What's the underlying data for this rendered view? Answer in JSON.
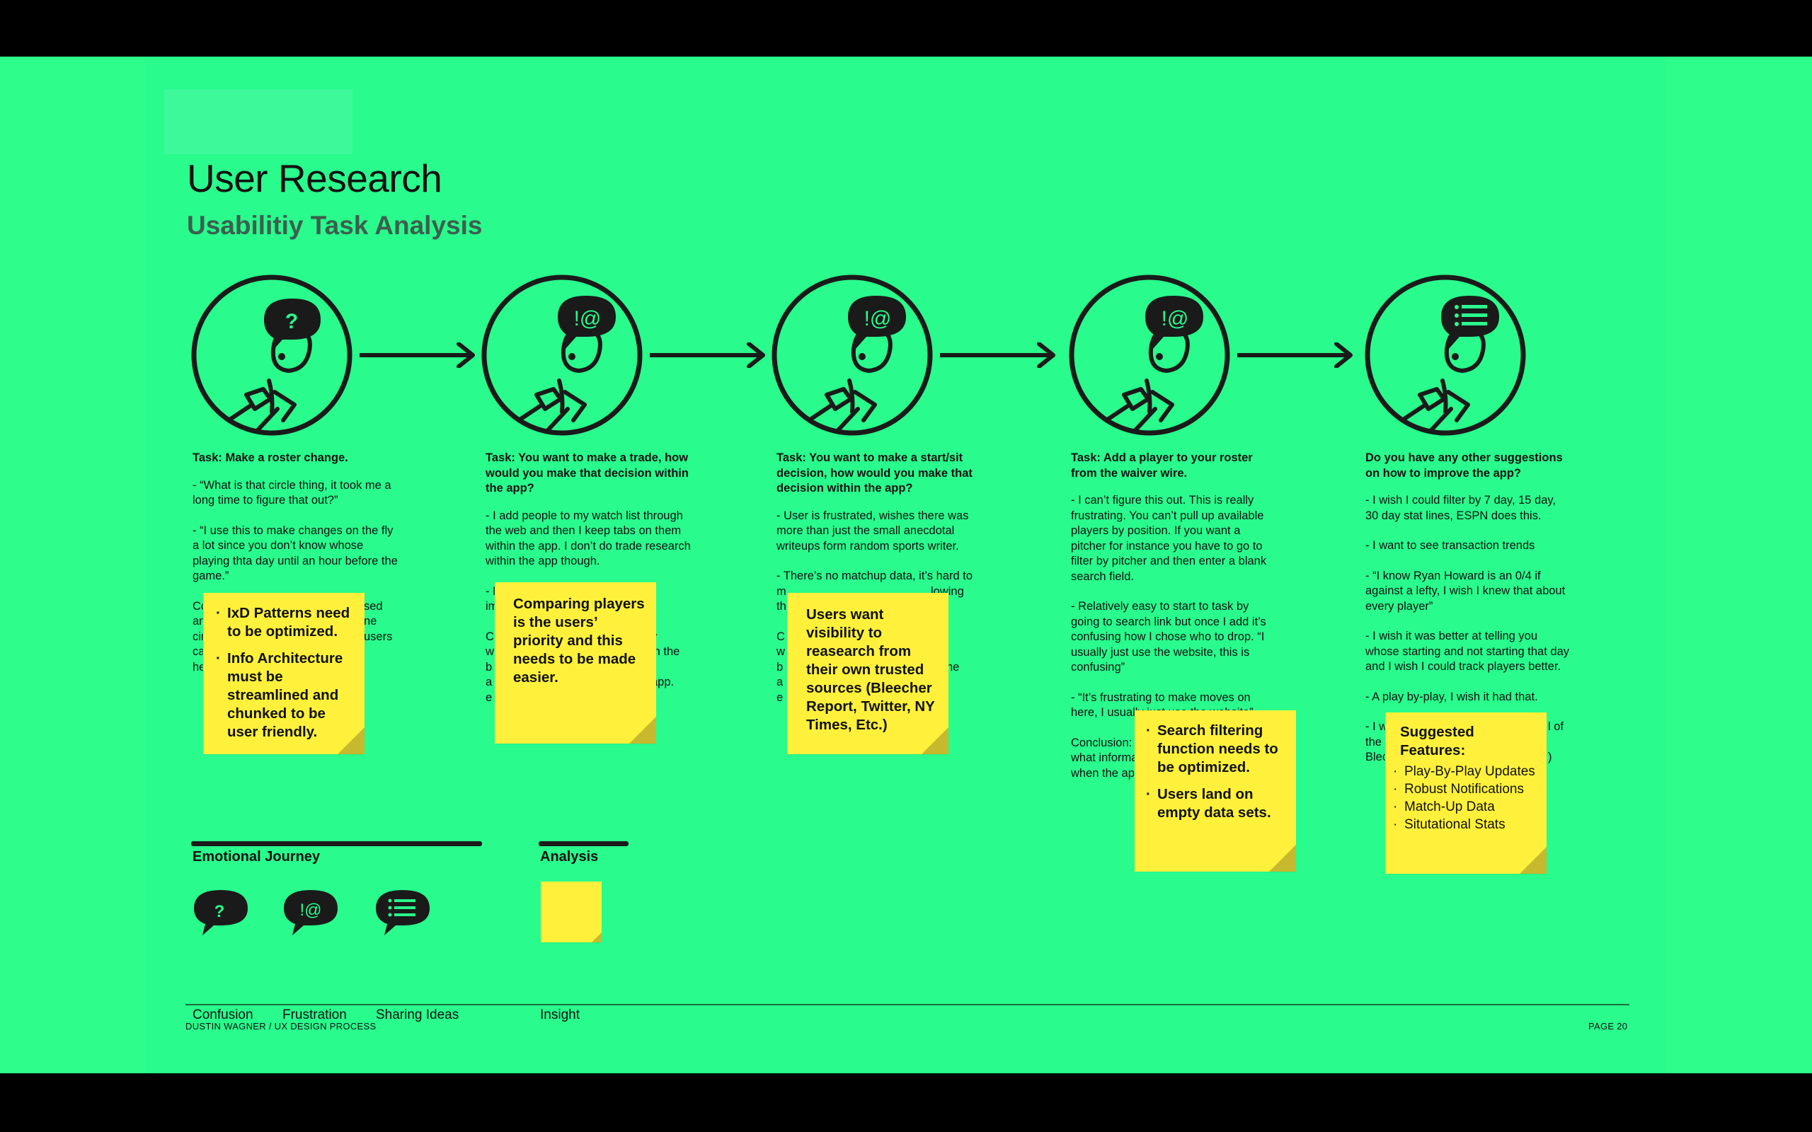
{
  "header": {
    "title": "User Research",
    "subtitle": "Usabilitiy Task Analysis"
  },
  "personas": [
    {
      "bubble": "?",
      "emotion": "confusion",
      "icon": "confusion-bubble-icon"
    },
    {
      "bubble": "!@",
      "emotion": "frustration",
      "icon": "frustration-bubble-icon"
    },
    {
      "bubble": "!@",
      "emotion": "frustration",
      "icon": "frustration-bubble-icon"
    },
    {
      "bubble": "!@",
      "emotion": "frustration",
      "icon": "frustration-bubble-icon"
    },
    {
      "bubble": "list",
      "emotion": "sharing-ideas",
      "icon": "sharing-ideas-bubble-icon"
    }
  ],
  "tasks": [
    {
      "title": "Task: Make a roster change.",
      "paragraphs": [
        "- “What is that circle thing, it took me a long time to figure that out?”",
        "- “I use this to make changes on the fly a lot since you don’t know whose playing thta day until an hour before the game.”"
      ]
    },
    {
      "title": "Task: You want to make a trade, how would you make that decision within the app?",
      "paragraphs": [
        "- I add people to my watch list through the web and then I keep tabs on them within the app. I don’t do trade research within the app though."
      ]
    },
    {
      "title": "Task: You want to make a start/sit decision, how would you make that decision within the app?",
      "paragraphs": [
        "- User is frustrated, wishes there was more than just the small anecdotal writeups form random sports writer."
      ]
    },
    {
      "title": "Task: Add a player to your roster from the waiver wire.",
      "paragraphs": [
        "- I can’t figure this out. This is really frustrating. You can’t pull up available players by position. If you want a pitcher for instance you have to go to filter by pitcher and then enter a blank search field.",
        "- Relatively easy to start to task by going to search link but once I add it’s confusing how I chose who to drop. “I usually just use the website, this is confusing”",
        "- “It’s frustrating to make moves on here, I usually just use the website”"
      ]
    },
    {
      "title": "Do you have any other suggestions on how to improve the app?",
      "paragraphs": [
        "- I wish I could filter by 7 day, 15 day, 30 day stat lines, ESPN does this.",
        "- I want to see transaction trends",
        "- “I know Ryan Howard is an 0/4 if against a lefty, I wish I knew that about every player”",
        "- I wish it was better at telling you whose starting and not starting that day and I wish I could track players better.",
        "- A play by-play, I wish it had that."
      ]
    }
  ],
  "hidden_fragments": {
    "t1": [
      "Co",
      "an",
      "cir",
      "ca",
      "he"
    ],
    "t1_right": [
      "sed",
      "ne",
      "users"
    ],
    "t2": [
      "- N",
      "im",
      "C",
      "w",
      "b",
      "a",
      "e"
    ],
    "t2_right": [
      "y",
      "in the",
      "app."
    ],
    "t3": [
      "m",
      "th",
      "C",
      "w",
      "b",
      "a",
      "e"
    ],
    "t3_right": [
      "lowing",
      "n",
      "in the"
    ],
    "t3_top": "- There’s no matchup data, it’s hard to",
    "t4_conclusion": [
      "Conclusion: T",
      "what informa",
      "when the app"
    ],
    "t5": [
      "- I w",
      "the r",
      "Blec"
    ],
    "t5_right": [
      "l of",
      ")"
    ]
  },
  "stickies": [
    {
      "items": [
        "IxD Patterns need to be optimized.",
        "Info Architecture must be streamlined and chunked to be user friendly."
      ]
    },
    {
      "text": "Comparing players is the users’ priority and this needs to be made easier."
    },
    {
      "text": "Users want visibility to reasearch from their own trusted sources (Bleecher Report, Twitter, NY Times, Etc.)"
    },
    {
      "items": [
        "Search filtering function needs to be optimized.",
        "Users land on empty data sets."
      ]
    },
    {
      "heading": "Suggested Features:",
      "items": [
        "Play-By-Play Updates",
        "Robust Notifications",
        "Match-Up Data",
        "Situtational Stats"
      ]
    }
  ],
  "legend": {
    "journey_title": "Emotional Journey",
    "analysis_title": "Analysis",
    "items": [
      {
        "label": "Confusion",
        "icon": "confusion-bubble-icon"
      },
      {
        "label": "Frustration",
        "icon": "frustration-bubble-icon"
      },
      {
        "label": "Sharing Ideas",
        "icon": "sharing-ideas-bubble-icon"
      }
    ],
    "insight_label": "Insight"
  },
  "footer": {
    "left": "DUSTIN WAGNER  /  UX DESIGN PROCESS",
    "right": "PAGE 20"
  },
  "colors": {
    "background": "#29fb8c",
    "sticky": "#fff13b",
    "sticky_fold": "#c7b92e",
    "ink": "#1a1a1a"
  }
}
